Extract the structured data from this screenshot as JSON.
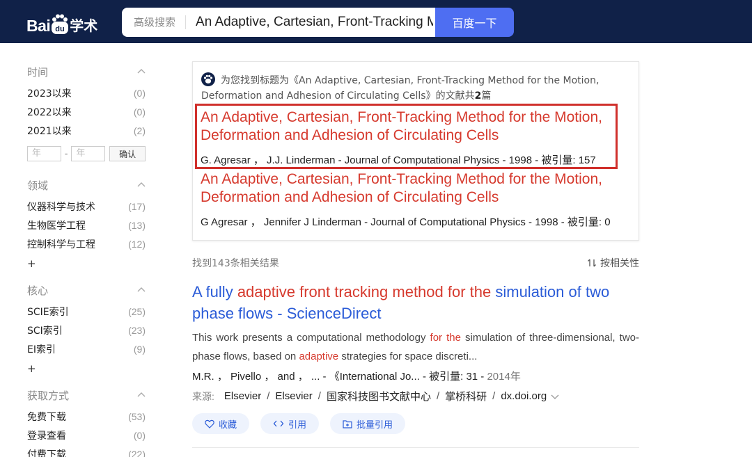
{
  "header": {
    "logo_text": "Bai",
    "logo_paw_text": "du",
    "logo_cn": "学术",
    "advanced_search_label": "高级搜索",
    "search_value": "An Adaptive, Cartesian, Front-Tracking Method for the Motion, Deformation and Adhesion of Circulating Cells",
    "search_button": "百度一下",
    "bg_color": "#102148",
    "button_color": "#4e6ef2"
  },
  "sidebar": {
    "time": {
      "title": "时间",
      "items": [
        {
          "label": "2023以来",
          "count": "(0)"
        },
        {
          "label": "2022以来",
          "count": "(0)"
        },
        {
          "label": "2021以来",
          "count": "(2)"
        }
      ],
      "year_from_placeholder": "年",
      "year_dash": "-",
      "year_to_placeholder": "年",
      "confirm": "确认"
    },
    "field": {
      "title": "领域",
      "items": [
        {
          "label": "仪器科学与技术",
          "count": "(17)"
        },
        {
          "label": "生物医学工程",
          "count": "(13)"
        },
        {
          "label": "控制科学与工程",
          "count": "(12)"
        }
      ],
      "more": "+"
    },
    "core": {
      "title": "核心",
      "items": [
        {
          "label": "SCIE索引",
          "count": "(25)"
        },
        {
          "label": "SCI索引",
          "count": "(23)"
        },
        {
          "label": "EI索引",
          "count": "(9)"
        }
      ],
      "more": "+"
    },
    "access": {
      "title": "获取方式",
      "items": [
        {
          "label": "免费下载",
          "count": "(53)"
        },
        {
          "label": "登录查看",
          "count": "(0)"
        },
        {
          "label": "付费下载",
          "count": "(22)"
        }
      ]
    }
  },
  "match_card": {
    "head_prefix": "为您找到标题为《An Adaptive, Cartesian, Front-Tracking Method for the Motion, Deformation and Adhesion of Circulating Cells》的文献共",
    "head_count": "2",
    "head_suffix": "篇",
    "results": [
      {
        "title": "An Adaptive, Cartesian, Front-Tracking Method for the Motion, Deformation and Adhesion of Circulating Cells",
        "meta": "G. Agresar ，  J.J. Linderman  -  Journal of Computational Physics  -  1998  - 被引量: 157"
      },
      {
        "title": "An Adaptive, Cartesian, Front-Tracking Method for the Motion, Deformation and Adhesion of Circulating Cells",
        "meta": "G Agresar ，  Jennifer J Linderman  -  Journal of Computational Physics  -  1998  - 被引量: 0"
      }
    ],
    "highlight_color": "#d0302c"
  },
  "results_bar": {
    "found": "找到143条相关结果",
    "sort": "按相关性"
  },
  "result": {
    "title_parts": [
      "A fully ",
      "adaptive front tracking method for the",
      " simulation of two phase flows - ScienceDirect"
    ],
    "abstract_parts": [
      "This work presents a computational methodology ",
      "for the",
      " simulation of three-dimensional, two-phase flows, based on ",
      "adaptive",
      " strategies for space discreti..."
    ],
    "authors": "M.R. ，  Pivello ，  and ，  ... -  《International Jo...  -  被引量:  31  -  ",
    "year": "2014年",
    "source_label": "来源:",
    "sources": [
      "Elsevier",
      "Elsevier",
      "国家科技图书文献中心",
      "掌桥科研",
      "dx.doi.org"
    ],
    "actions": [
      "收藏",
      "引用",
      "批量引用"
    ],
    "link_color": "#2a5bd7",
    "highlight_color": "#d63a2e"
  }
}
